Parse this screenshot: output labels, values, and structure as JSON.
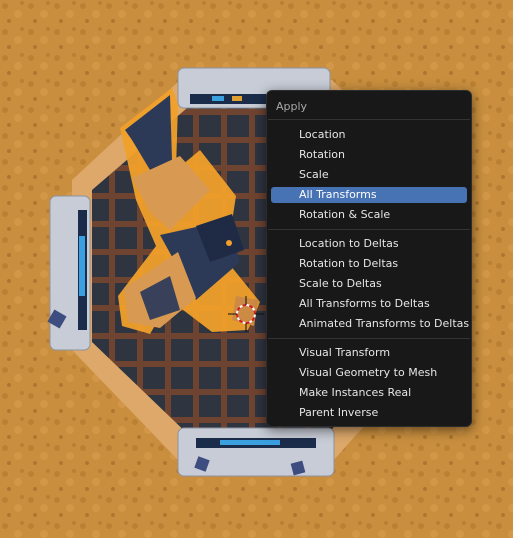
{
  "menu": {
    "title": "Apply",
    "groups": [
      [
        "Location",
        "Rotation",
        "Scale",
        "All Transforms",
        "Rotation & Scale"
      ],
      [
        "Location to Deltas",
        "Rotation to Deltas",
        "Scale to Deltas",
        "All Transforms to Deltas",
        "Animated Transforms to Deltas"
      ],
      [
        "Visual Transform",
        "Visual Geometry to Mesh",
        "Make Instances Real",
        "Parent Inverse"
      ]
    ],
    "highlighted": "All Transforms"
  },
  "colors": {
    "ground": "#c98f3e",
    "menu_bg": "#181818",
    "highlight": "#4772b3",
    "selection_outline": "#f0a02a",
    "floor": "#6e4430"
  }
}
